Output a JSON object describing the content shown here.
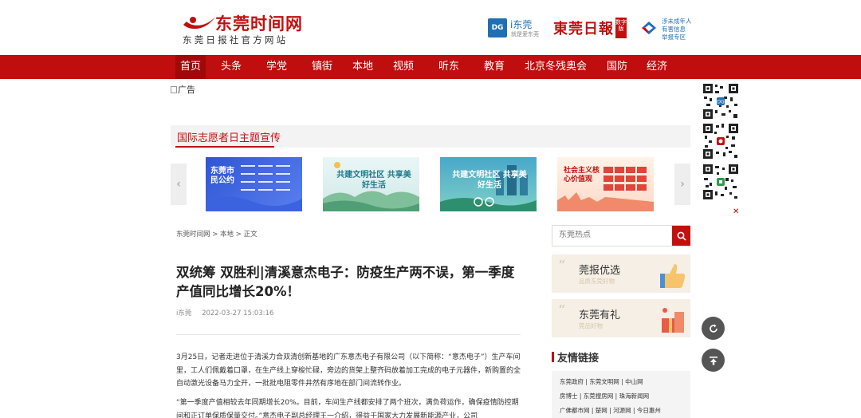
{
  "header": {
    "logo_title": "东莞时间网",
    "logo_subtitle": "东莞日报社官方网站",
    "idg_badge": "DG",
    "idg_name": "i东莞",
    "idg_slogan": "就是爱东莞",
    "dgrb_name": "東莞日報",
    "dgrb_tag": "数字版",
    "minor_report": [
      "涉未成年人",
      "有害信息",
      "举报专区"
    ]
  },
  "nav": {
    "items": [
      "首页",
      "头条",
      "学党史",
      "镇街",
      "本地",
      "视频",
      "听东莞",
      "教育",
      "北京冬残奥会",
      "国防",
      "经济"
    ],
    "active": "首页"
  },
  "ad": {
    "alt": "广告"
  },
  "topic": {
    "title": "国际志愿者日主题宣传",
    "banners": [
      {
        "text": "东莞市民公约"
      },
      {
        "text": "共建文明社区 共享美好生活"
      },
      {
        "text": "共建文明社区 共享美好生活"
      },
      {
        "text": "社会主义核心价值观"
      }
    ]
  },
  "article": {
    "breadcrumb": [
      "东莞时间网",
      "本地",
      "正文"
    ],
    "title": "双统筹 双胜利|清溪意杰电子：防疫生产两不误，第一季度产值同比增长20%！",
    "source": "i东莞",
    "datetime": "2022-03-27 15:03:16",
    "paragraphs": [
      "3月25日，记者走进位于清溪力合双清创新基地的广东意杰电子有限公司（以下简称：“意杰电子”）生产车间里，工人们佩戴着口罩，在生产线上穿梭忙碌，旁边的货架上整齐码放着加工完成的电子元器件，新购置的全自动激光设备马力全开，一批批电阻零件井然有序地在部门间流转作业。",
      "“第一季度产值相较去年同期增长20%。目前，车间生产线都安排了两个班次，满负荷运作，确保疫情防控期间和正订单保质保量交付。”意杰电子副总经理王一介绍，得益于国家大力发展新能源产业，公司"
    ]
  },
  "sidebar": {
    "search_placeholder": "东莞热点",
    "promos": [
      {
        "title": "莞报优选",
        "subtitle": "品质东莞好物"
      },
      {
        "title": "东莞有礼",
        "subtitle": "莞品好物"
      }
    ],
    "links_title": "友情链接",
    "links": [
      [
        "东莞政府",
        "东莞文明网",
        "中山网"
      ],
      [
        "房博士",
        "东莞搜房网",
        "珠海新闻网"
      ],
      [
        "广佛都市网",
        "楚网",
        "河源网",
        "今日惠州"
      ]
    ]
  },
  "colors": {
    "brand_red": "#c40f0f",
    "nav_red": "#c00d0d",
    "idg_blue": "#1f6fb5"
  }
}
